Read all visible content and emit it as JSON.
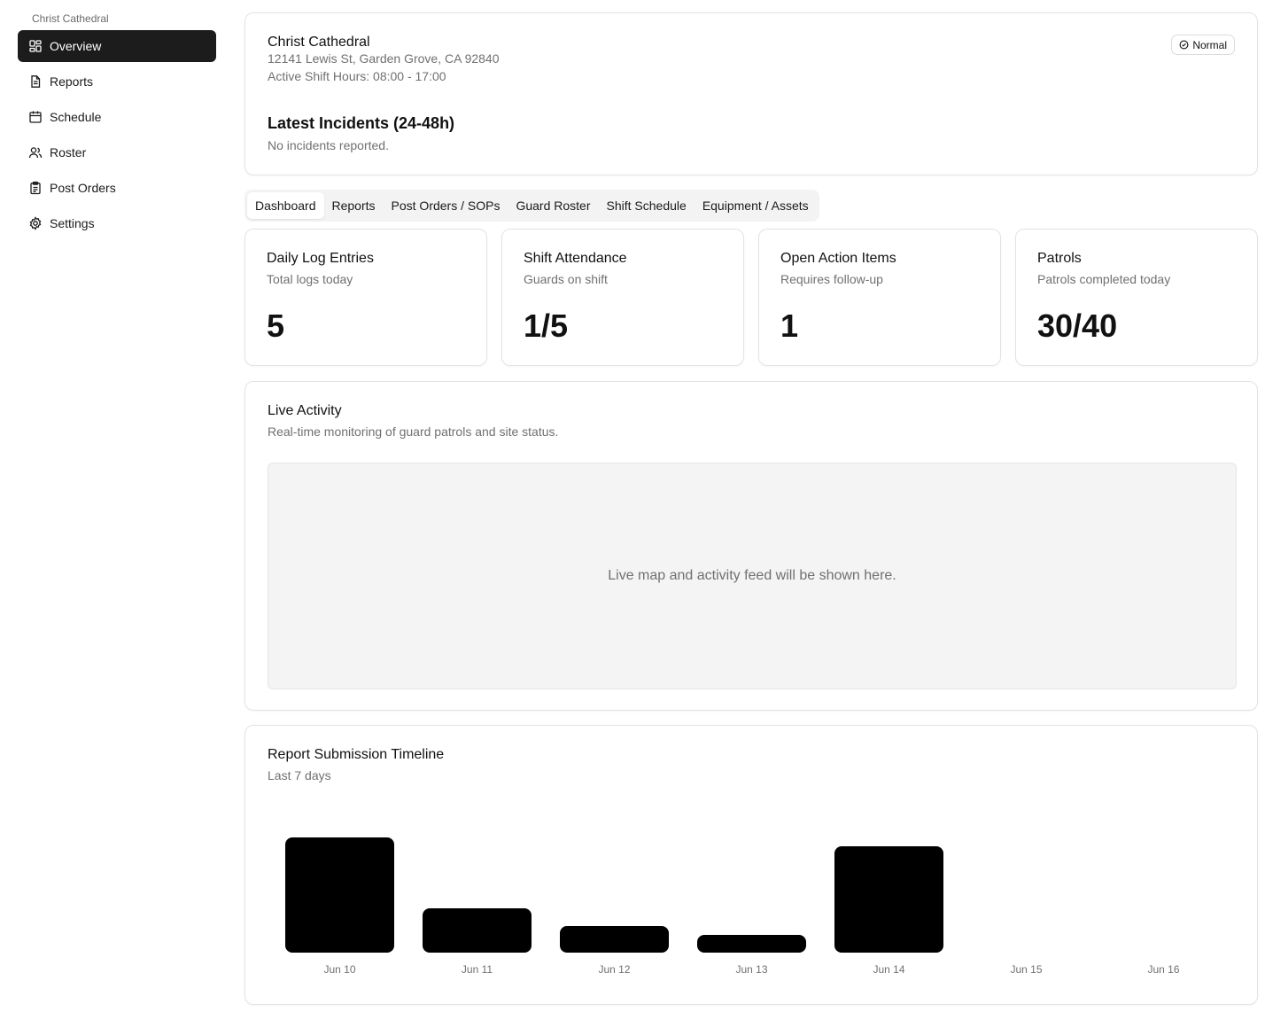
{
  "sidebar": {
    "site_label": "Christ Cathedral",
    "items": [
      {
        "label": "Overview",
        "icon": "dashboard-grid-icon",
        "active": true
      },
      {
        "label": "Reports",
        "icon": "document-icon",
        "active": false
      },
      {
        "label": "Schedule",
        "icon": "calendar-icon",
        "active": false
      },
      {
        "label": "Roster",
        "icon": "users-icon",
        "active": false
      },
      {
        "label": "Post Orders",
        "icon": "clipboard-icon",
        "active": false
      },
      {
        "label": "Settings",
        "icon": "gear-icon",
        "active": false
      }
    ]
  },
  "site": {
    "name": "Christ Cathedral",
    "address": "12141 Lewis St, Garden Grove, CA 92840",
    "hours": "Active Shift Hours: 08:00 - 17:00",
    "status": "Normal",
    "status_icon": "check-circle-icon"
  },
  "incidents": {
    "title": "Latest Incidents (24-48h)",
    "text": "No incidents reported."
  },
  "tabs": [
    {
      "label": "Dashboard",
      "active": true
    },
    {
      "label": "Reports",
      "active": false
    },
    {
      "label": "Post Orders / SOPs",
      "active": false
    },
    {
      "label": "Guard Roster",
      "active": false
    },
    {
      "label": "Shift Schedule",
      "active": false
    },
    {
      "label": "Equipment / Assets",
      "active": false
    }
  ],
  "stats": [
    {
      "title": "Daily Log Entries",
      "subtitle": "Total logs today",
      "value": "5"
    },
    {
      "title": "Shift Attendance",
      "subtitle": "Guards on shift",
      "value": "1/5"
    },
    {
      "title": "Open Action Items",
      "subtitle": "Requires follow-up",
      "value": "1"
    },
    {
      "title": "Patrols",
      "subtitle": "Patrols completed today",
      "value": "30/40"
    }
  ],
  "live": {
    "title": "Live Activity",
    "subtitle": "Real-time monitoring of guard patrols and site status.",
    "placeholder": "Live map and activity feed will be shown here."
  },
  "chart_data": {
    "type": "bar",
    "title": "Report Submission Timeline",
    "subtitle": "Last 7 days",
    "categories": [
      "Jun 10",
      "Jun 11",
      "Jun 12",
      "Jun 13",
      "Jun 14",
      "Jun 15",
      "Jun 16"
    ],
    "values": [
      13,
      5,
      3,
      2,
      12,
      0,
      0
    ],
    "ylim": [
      0,
      13
    ],
    "bar_color": "#000000",
    "grid": false
  }
}
